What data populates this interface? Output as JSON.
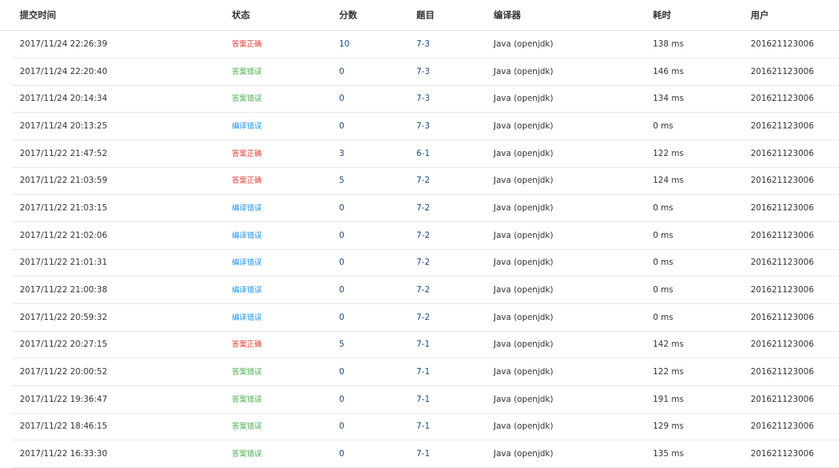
{
  "colors": {
    "accepted": "#e53935",
    "wrong_answer": "#4caf50",
    "compile_error": "#2196f3",
    "link": "#1a4a86"
  },
  "headers": {
    "time": "提交时间",
    "status": "状态",
    "score": "分数",
    "problem": "题目",
    "compiler": "编译器",
    "duration": "耗时",
    "user": "用户"
  },
  "rows": [
    {
      "time": "2017/11/24 22:26:39",
      "status": "答案正确",
      "status_type": "accepted",
      "score": "10",
      "problem": "7-3",
      "compiler": "Java (openjdk)",
      "duration": "138 ms",
      "user": "201621123006"
    },
    {
      "time": "2017/11/24 22:20:40",
      "status": "答案错误",
      "status_type": "wrong",
      "score": "0",
      "problem": "7-3",
      "compiler": "Java (openjdk)",
      "duration": "146 ms",
      "user": "201621123006"
    },
    {
      "time": "2017/11/24 20:14:34",
      "status": "答案错误",
      "status_type": "wrong",
      "score": "0",
      "problem": "7-3",
      "compiler": "Java (openjdk)",
      "duration": "134 ms",
      "user": "201621123006"
    },
    {
      "time": "2017/11/24 20:13:25",
      "status": "编译错误",
      "status_type": "compile",
      "score": "0",
      "problem": "7-3",
      "compiler": "Java (openjdk)",
      "duration": "0 ms",
      "user": "201621123006"
    },
    {
      "time": "2017/11/22 21:47:52",
      "status": "答案正确",
      "status_type": "accepted",
      "score": "3",
      "problem": "6-1",
      "compiler": "Java (openjdk)",
      "duration": "122 ms",
      "user": "201621123006"
    },
    {
      "time": "2017/11/22 21:03:59",
      "status": "答案正确",
      "status_type": "accepted",
      "score": "5",
      "problem": "7-2",
      "compiler": "Java (openjdk)",
      "duration": "124 ms",
      "user": "201621123006"
    },
    {
      "time": "2017/11/22 21:03:15",
      "status": "编译错误",
      "status_type": "compile",
      "score": "0",
      "problem": "7-2",
      "compiler": "Java (openjdk)",
      "duration": "0 ms",
      "user": "201621123006"
    },
    {
      "time": "2017/11/22 21:02:06",
      "status": "编译错误",
      "status_type": "compile",
      "score": "0",
      "problem": "7-2",
      "compiler": "Java (openjdk)",
      "duration": "0 ms",
      "user": "201621123006"
    },
    {
      "time": "2017/11/22 21:01:31",
      "status": "编译错误",
      "status_type": "compile",
      "score": "0",
      "problem": "7-2",
      "compiler": "Java (openjdk)",
      "duration": "0 ms",
      "user": "201621123006"
    },
    {
      "time": "2017/11/22 21:00:38",
      "status": "编译错误",
      "status_type": "compile",
      "score": "0",
      "problem": "7-2",
      "compiler": "Java (openjdk)",
      "duration": "0 ms",
      "user": "201621123006"
    },
    {
      "time": "2017/11/22 20:59:32",
      "status": "编译错误",
      "status_type": "compile",
      "score": "0",
      "problem": "7-2",
      "compiler": "Java (openjdk)",
      "duration": "0 ms",
      "user": "201621123006"
    },
    {
      "time": "2017/11/22 20:27:15",
      "status": "答案正确",
      "status_type": "accepted",
      "score": "5",
      "problem": "7-1",
      "compiler": "Java (openjdk)",
      "duration": "142 ms",
      "user": "201621123006"
    },
    {
      "time": "2017/11/22 20:00:52",
      "status": "答案错误",
      "status_type": "wrong",
      "score": "0",
      "problem": "7-1",
      "compiler": "Java (openjdk)",
      "duration": "122 ms",
      "user": "201621123006"
    },
    {
      "time": "2017/11/22 19:36:47",
      "status": "答案错误",
      "status_type": "wrong",
      "score": "0",
      "problem": "7-1",
      "compiler": "Java (openjdk)",
      "duration": "191 ms",
      "user": "201621123006"
    },
    {
      "time": "2017/11/22 18:46:15",
      "status": "答案错误",
      "status_type": "wrong",
      "score": "0",
      "problem": "7-1",
      "compiler": "Java (openjdk)",
      "duration": "129 ms",
      "user": "201621123006"
    },
    {
      "time": "2017/11/22 16:33:30",
      "status": "答案错误",
      "status_type": "wrong",
      "score": "0",
      "problem": "7-1",
      "compiler": "Java (openjdk)",
      "duration": "135 ms",
      "user": "201621123006"
    }
  ]
}
